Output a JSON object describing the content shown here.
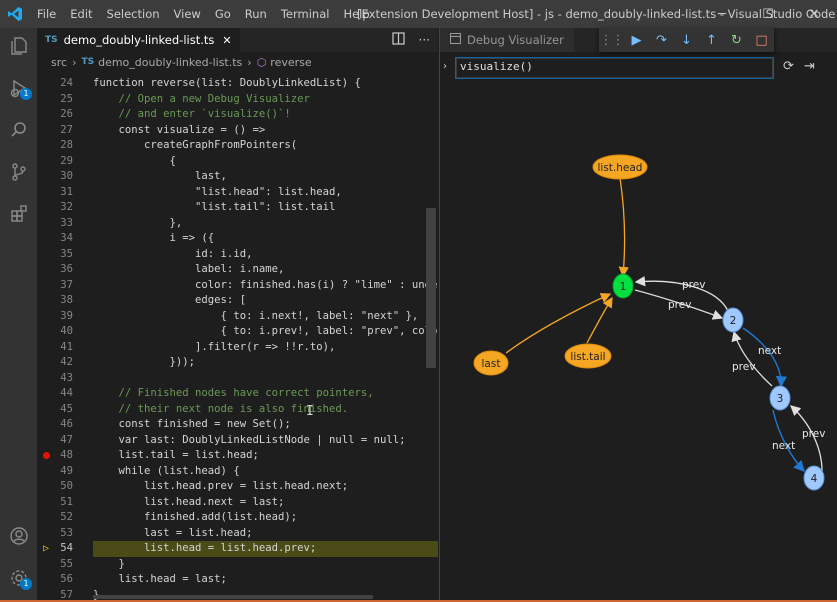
{
  "titlebar": {
    "menu": [
      "File",
      "Edit",
      "Selection",
      "View",
      "Go",
      "Run",
      "Terminal",
      "Help"
    ],
    "title": "[Extension Development Host] - js - demo_doubly-linked-list.ts - Visual Studio Code",
    "minimize": "─",
    "maximize": "☐",
    "close": "✕"
  },
  "activitybar": {
    "items": [
      "explorer-icon",
      "run-debug-icon",
      "search-icon",
      "source-control-icon",
      "extensions-icon"
    ],
    "debug_badge": "1",
    "bottom": [
      "account-icon",
      "manage-gear-icon"
    ],
    "gear_badge": "1"
  },
  "editor": {
    "tab": {
      "lang": "TS",
      "label": "demo_doubly-linked-list.ts",
      "close": "✕"
    },
    "breadcrumb": [
      "src",
      "demo_doubly-linked-list.ts",
      "reverse"
    ],
    "breadcrumb_lang": "TS",
    "lines": [
      {
        "n": "24",
        "text": "function reverse(list: DoublyLinkedList) {"
      },
      {
        "n": "25",
        "text": "    // Open a new Debug Visualizer"
      },
      {
        "n": "26",
        "text": "    // and enter `visualize()`!"
      },
      {
        "n": "27",
        "text": "    const visualize = () =>"
      },
      {
        "n": "28",
        "text": "        createGraphFromPointers("
      },
      {
        "n": "29",
        "text": "            {"
      },
      {
        "n": "30",
        "text": "                last,"
      },
      {
        "n": "31",
        "text": "                \"list.head\": list.head,"
      },
      {
        "n": "32",
        "text": "                \"list.tail\": list.tail"
      },
      {
        "n": "33",
        "text": "            },"
      },
      {
        "n": "34",
        "text": "            i => ({"
      },
      {
        "n": "35",
        "text": "                id: i.id,"
      },
      {
        "n": "36",
        "text": "                label: i.name,"
      },
      {
        "n": "37",
        "text": "                color: finished.has(i) ? \"lime\" : undef"
      },
      {
        "n": "38",
        "text": "                edges: ["
      },
      {
        "n": "39",
        "text": "                    { to: i.next!, label: \"next\" },"
      },
      {
        "n": "40",
        "text": "                    { to: i.prev!, label: \"prev\", color"
      },
      {
        "n": "41",
        "text": "                ].filter(r => !!r.to),"
      },
      {
        "n": "42",
        "text": "            }));"
      },
      {
        "n": "43",
        "text": ""
      },
      {
        "n": "44",
        "text": "    // Finished nodes have correct pointers,"
      },
      {
        "n": "45",
        "text": "    // their next node is also finished."
      },
      {
        "n": "46",
        "text": "    const finished = new Set();"
      },
      {
        "n": "47",
        "text": "    var last: DoublyLinkedListNode | null = null;"
      },
      {
        "n": "48",
        "text": "    list.tail = list.head;"
      },
      {
        "n": "49",
        "text": "    while (list.head) {"
      },
      {
        "n": "50",
        "text": "        list.head.prev = list.head.next;"
      },
      {
        "n": "51",
        "text": "        list.head.next = last;"
      },
      {
        "n": "52",
        "text": "        finished.add(list.head);"
      },
      {
        "n": "53",
        "text": "        last = list.head;"
      },
      {
        "n": "54",
        "text": "        list.head = list.head.prev;"
      },
      {
        "n": "55",
        "text": "    }"
      },
      {
        "n": "56",
        "text": "    list.head = last;"
      },
      {
        "n": "57",
        "text": "}"
      }
    ],
    "breakpoint_line": "48",
    "current_line": "54"
  },
  "visualizer": {
    "tab_label": "Debug Visualizer",
    "expression": "visualize()",
    "chevron": "›",
    "nodes": [
      {
        "id": "1",
        "label": "1",
        "color": "#00e040"
      },
      {
        "id": "2",
        "label": "2",
        "color": "#9fc8ff"
      },
      {
        "id": "3",
        "label": "3",
        "color": "#9fc8ff"
      },
      {
        "id": "4",
        "label": "4",
        "color": "#9fc8ff"
      },
      {
        "id": "list.head",
        "label": "list.head",
        "color": "#f5a623"
      },
      {
        "id": "last",
        "label": "last",
        "color": "#f5a623"
      },
      {
        "id": "list.tail",
        "label": "list.tail",
        "color": "#f5a623"
      }
    ],
    "edge_labels": [
      "prev",
      "prev",
      "next",
      "prev",
      "next",
      "prev"
    ]
  }
}
